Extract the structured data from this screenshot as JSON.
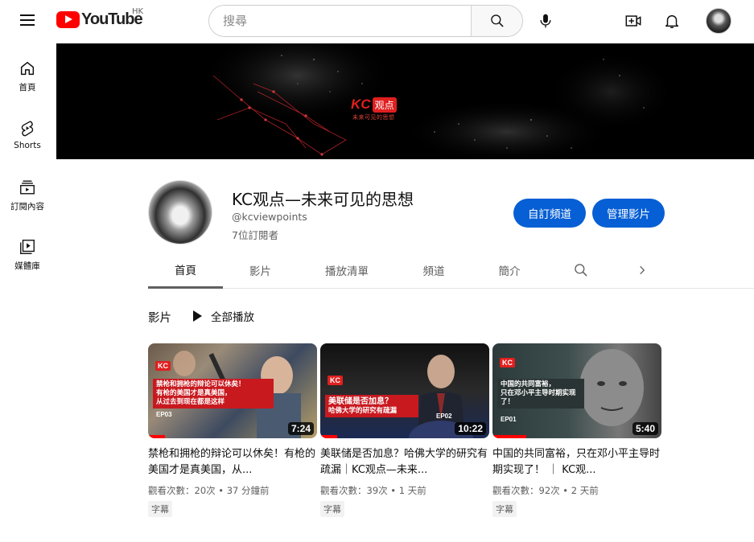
{
  "header": {
    "logo_text": "YouTube",
    "region": "HK",
    "search_placeholder": "搜尋"
  },
  "sidebar": {
    "items": [
      {
        "label": "首頁",
        "icon": "home-icon"
      },
      {
        "label": "Shorts",
        "icon": "shorts-icon"
      },
      {
        "label": "訂閱內容",
        "icon": "subscriptions-icon"
      },
      {
        "label": "媒體庫",
        "icon": "library-icon"
      }
    ]
  },
  "banner": {
    "brand": "KC",
    "brand_box": "观点",
    "tagline": "未来可见的思想"
  },
  "channel": {
    "name": "KC观点—未来可见的思想",
    "handle": "@kcviewpoints",
    "subscribers": "7位訂閱者",
    "customize_label": "自訂頻道",
    "manage_label": "管理影片"
  },
  "tabs": [
    {
      "label": "首頁"
    },
    {
      "label": "影片"
    },
    {
      "label": "播放清單"
    },
    {
      "label": "頻道"
    },
    {
      "label": "簡介"
    }
  ],
  "section": {
    "title": "影片",
    "play_all": "全部播放"
  },
  "videos": [
    {
      "title": "禁枪和拥枪的辩论可以休矣！有枪的美国才是真美国，从...",
      "thumb_caption_1": "禁枪和拥枪的辩论可以休矣！",
      "thumb_caption_2": "有枪的美国才是真美国，",
      "thumb_caption_3": "从过去到现在都是这样",
      "episode": "EP03",
      "duration": "7:24",
      "meta": "觀看次數：20次 • 37 分鐘前",
      "badge": "字幕",
      "progress": 0.1
    },
    {
      "title": "美联储是否加息？哈佛大学的研究有疏漏｜KC观点—未来...",
      "thumb_caption_1": "美联储是否加息？",
      "thumb_caption_2": "哈佛大学的研究有疏漏",
      "episode": "EP02",
      "duration": "10:22",
      "meta": "觀看次數：39次 • 1 天前",
      "badge": "字幕",
      "progress": 0.1
    },
    {
      "title": "中国的共同富裕，只在邓小平主导时期实现了！ ｜ KC观...",
      "thumb_caption_1": "中国的共同富裕，",
      "thumb_caption_2": "只在邓小平主导时期实现了！",
      "episode": "EP01",
      "duration": "5:40",
      "meta": "觀看次數：92次 • 2 天前",
      "badge": "字幕",
      "progress": 0.2
    }
  ],
  "colors": {
    "brand_red": "#ff0000",
    "accent_blue": "#065fd4",
    "thumb_red": "#c8191f"
  }
}
